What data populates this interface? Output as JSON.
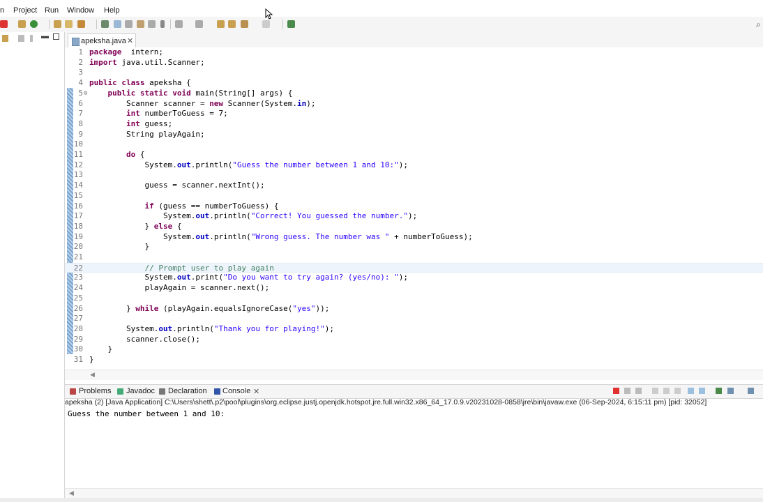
{
  "menu": {
    "items": [
      "Project",
      "Run",
      "Window",
      "Help"
    ],
    "partial": "n"
  },
  "editor": {
    "tab_label": "apeksha.java",
    "tab_close": "✕",
    "lines": [
      {
        "n": "1",
        "code": [
          [
            "kw",
            "package"
          ],
          [
            "",
            "  intern;"
          ]
        ]
      },
      {
        "n": "2",
        "code": [
          [
            "kw",
            "import"
          ],
          [
            "",
            " java.util.Scanner;"
          ]
        ]
      },
      {
        "n": "3",
        "code": []
      },
      {
        "n": "4",
        "code": [
          [
            "kw",
            "public class"
          ],
          [
            "",
            " apeksha {"
          ]
        ]
      },
      {
        "n": "5",
        "fold": "⊖",
        "code": [
          [
            "",
            "    "
          ],
          [
            "kw",
            "public static void"
          ],
          [
            "",
            " main(String[] args) {"
          ]
        ]
      },
      {
        "n": "6",
        "code": [
          [
            "",
            "        Scanner scanner = "
          ],
          [
            "kw",
            "new"
          ],
          [
            "",
            " Scanner(System."
          ],
          [
            "fld",
            "in"
          ],
          [
            "",
            ");"
          ]
        ]
      },
      {
        "n": "7",
        "code": [
          [
            "",
            "        "
          ],
          [
            "kw",
            "int"
          ],
          [
            "",
            " numberToGuess = 7;"
          ]
        ]
      },
      {
        "n": "8",
        "code": [
          [
            "",
            "        "
          ],
          [
            "kw",
            "int"
          ],
          [
            "",
            " guess;"
          ]
        ]
      },
      {
        "n": "9",
        "code": [
          [
            "",
            "        String playAgain;"
          ]
        ]
      },
      {
        "n": "10",
        "code": []
      },
      {
        "n": "11",
        "code": [
          [
            "",
            "        "
          ],
          [
            "kw",
            "do"
          ],
          [
            "",
            " {"
          ]
        ]
      },
      {
        "n": "12",
        "code": [
          [
            "",
            "            System."
          ],
          [
            "fld",
            "out"
          ],
          [
            "",
            ".println("
          ],
          [
            "str",
            "\"Guess the number between 1 and 10:\""
          ],
          [
            "",
            ");"
          ]
        ]
      },
      {
        "n": "13",
        "code": []
      },
      {
        "n": "14",
        "code": [
          [
            "",
            "            guess = scanner.nextInt();"
          ]
        ]
      },
      {
        "n": "15",
        "code": []
      },
      {
        "n": "16",
        "code": [
          [
            "",
            "            "
          ],
          [
            "kw",
            "if"
          ],
          [
            "",
            " (guess == numberToGuess) {"
          ]
        ]
      },
      {
        "n": "17",
        "code": [
          [
            "",
            "                System."
          ],
          [
            "fld",
            "out"
          ],
          [
            "",
            ".println("
          ],
          [
            "str",
            "\"Correct! You guessed the number.\""
          ],
          [
            "",
            ");"
          ]
        ]
      },
      {
        "n": "18",
        "code": [
          [
            "",
            "            } "
          ],
          [
            "kw",
            "else"
          ],
          [
            "",
            " {"
          ]
        ]
      },
      {
        "n": "19",
        "code": [
          [
            "",
            "                System."
          ],
          [
            "fld",
            "out"
          ],
          [
            "",
            ".println("
          ],
          [
            "str",
            "\"Wrong guess. The number was \""
          ],
          [
            "",
            " + numberToGuess);"
          ]
        ]
      },
      {
        "n": "20",
        "code": [
          [
            "",
            "            }"
          ]
        ]
      },
      {
        "n": "21",
        "code": []
      },
      {
        "n": "22",
        "hl": true,
        "code": [
          [
            "",
            "            "
          ],
          [
            "cmt",
            "// Prompt user to play again"
          ]
        ]
      },
      {
        "n": "23",
        "code": [
          [
            "",
            "            System."
          ],
          [
            "fld",
            "out"
          ],
          [
            "",
            ".print("
          ],
          [
            "str",
            "\"Do you want to try again? (yes/no): \""
          ],
          [
            "",
            ");"
          ]
        ]
      },
      {
        "n": "24",
        "code": [
          [
            "",
            "            playAgain = scanner.next();"
          ]
        ]
      },
      {
        "n": "25",
        "code": []
      },
      {
        "n": "26",
        "code": [
          [
            "",
            "        } "
          ],
          [
            "kw",
            "while"
          ],
          [
            "",
            " (playAgain.equalsIgnoreCase("
          ],
          [
            "str",
            "\"yes\""
          ],
          [
            "",
            "));"
          ]
        ]
      },
      {
        "n": "27",
        "code": []
      },
      {
        "n": "28",
        "code": [
          [
            "",
            "        System."
          ],
          [
            "fld",
            "out"
          ],
          [
            "",
            ".println("
          ],
          [
            "str",
            "\"Thank you for playing!\""
          ],
          [
            "",
            ");"
          ]
        ]
      },
      {
        "n": "29",
        "code": [
          [
            "",
            "        scanner.close();"
          ]
        ]
      },
      {
        "n": "30",
        "code": [
          [
            "",
            "    }"
          ]
        ]
      },
      {
        "n": "31",
        "code": [
          [
            "",
            "}"
          ]
        ]
      }
    ]
  },
  "bottom_tabs": [
    {
      "label": "Problems",
      "icon": "problems-icon",
      "color": "#b44"
    },
    {
      "label": "Javadoc",
      "icon": "javadoc-icon",
      "color": "#4a7"
    },
    {
      "label": "Declaration",
      "icon": "declaration-icon",
      "color": "#777"
    },
    {
      "label": "Console",
      "icon": "console-icon",
      "color": "#35a",
      "active": true
    }
  ],
  "console": {
    "close": "✕",
    "header": "apeksha (2) [Java Application] C:\\Users\\shett\\.p2\\pool\\plugins\\org.eclipse.justj.openjdk.hotspot.jre.full.win32.x86_64_17.0.9.v20231028-0858\\jre\\bin\\javaw.exe  (06-Sep-2024, 6:15:11 pm) [pid: 32052]",
    "output": "Guess the number between 1 and 10:"
  },
  "colors": {
    "terminate": "#e03030",
    "keyword": "#7f0055",
    "string": "#2a00ff",
    "comment": "#3f7f5f"
  }
}
